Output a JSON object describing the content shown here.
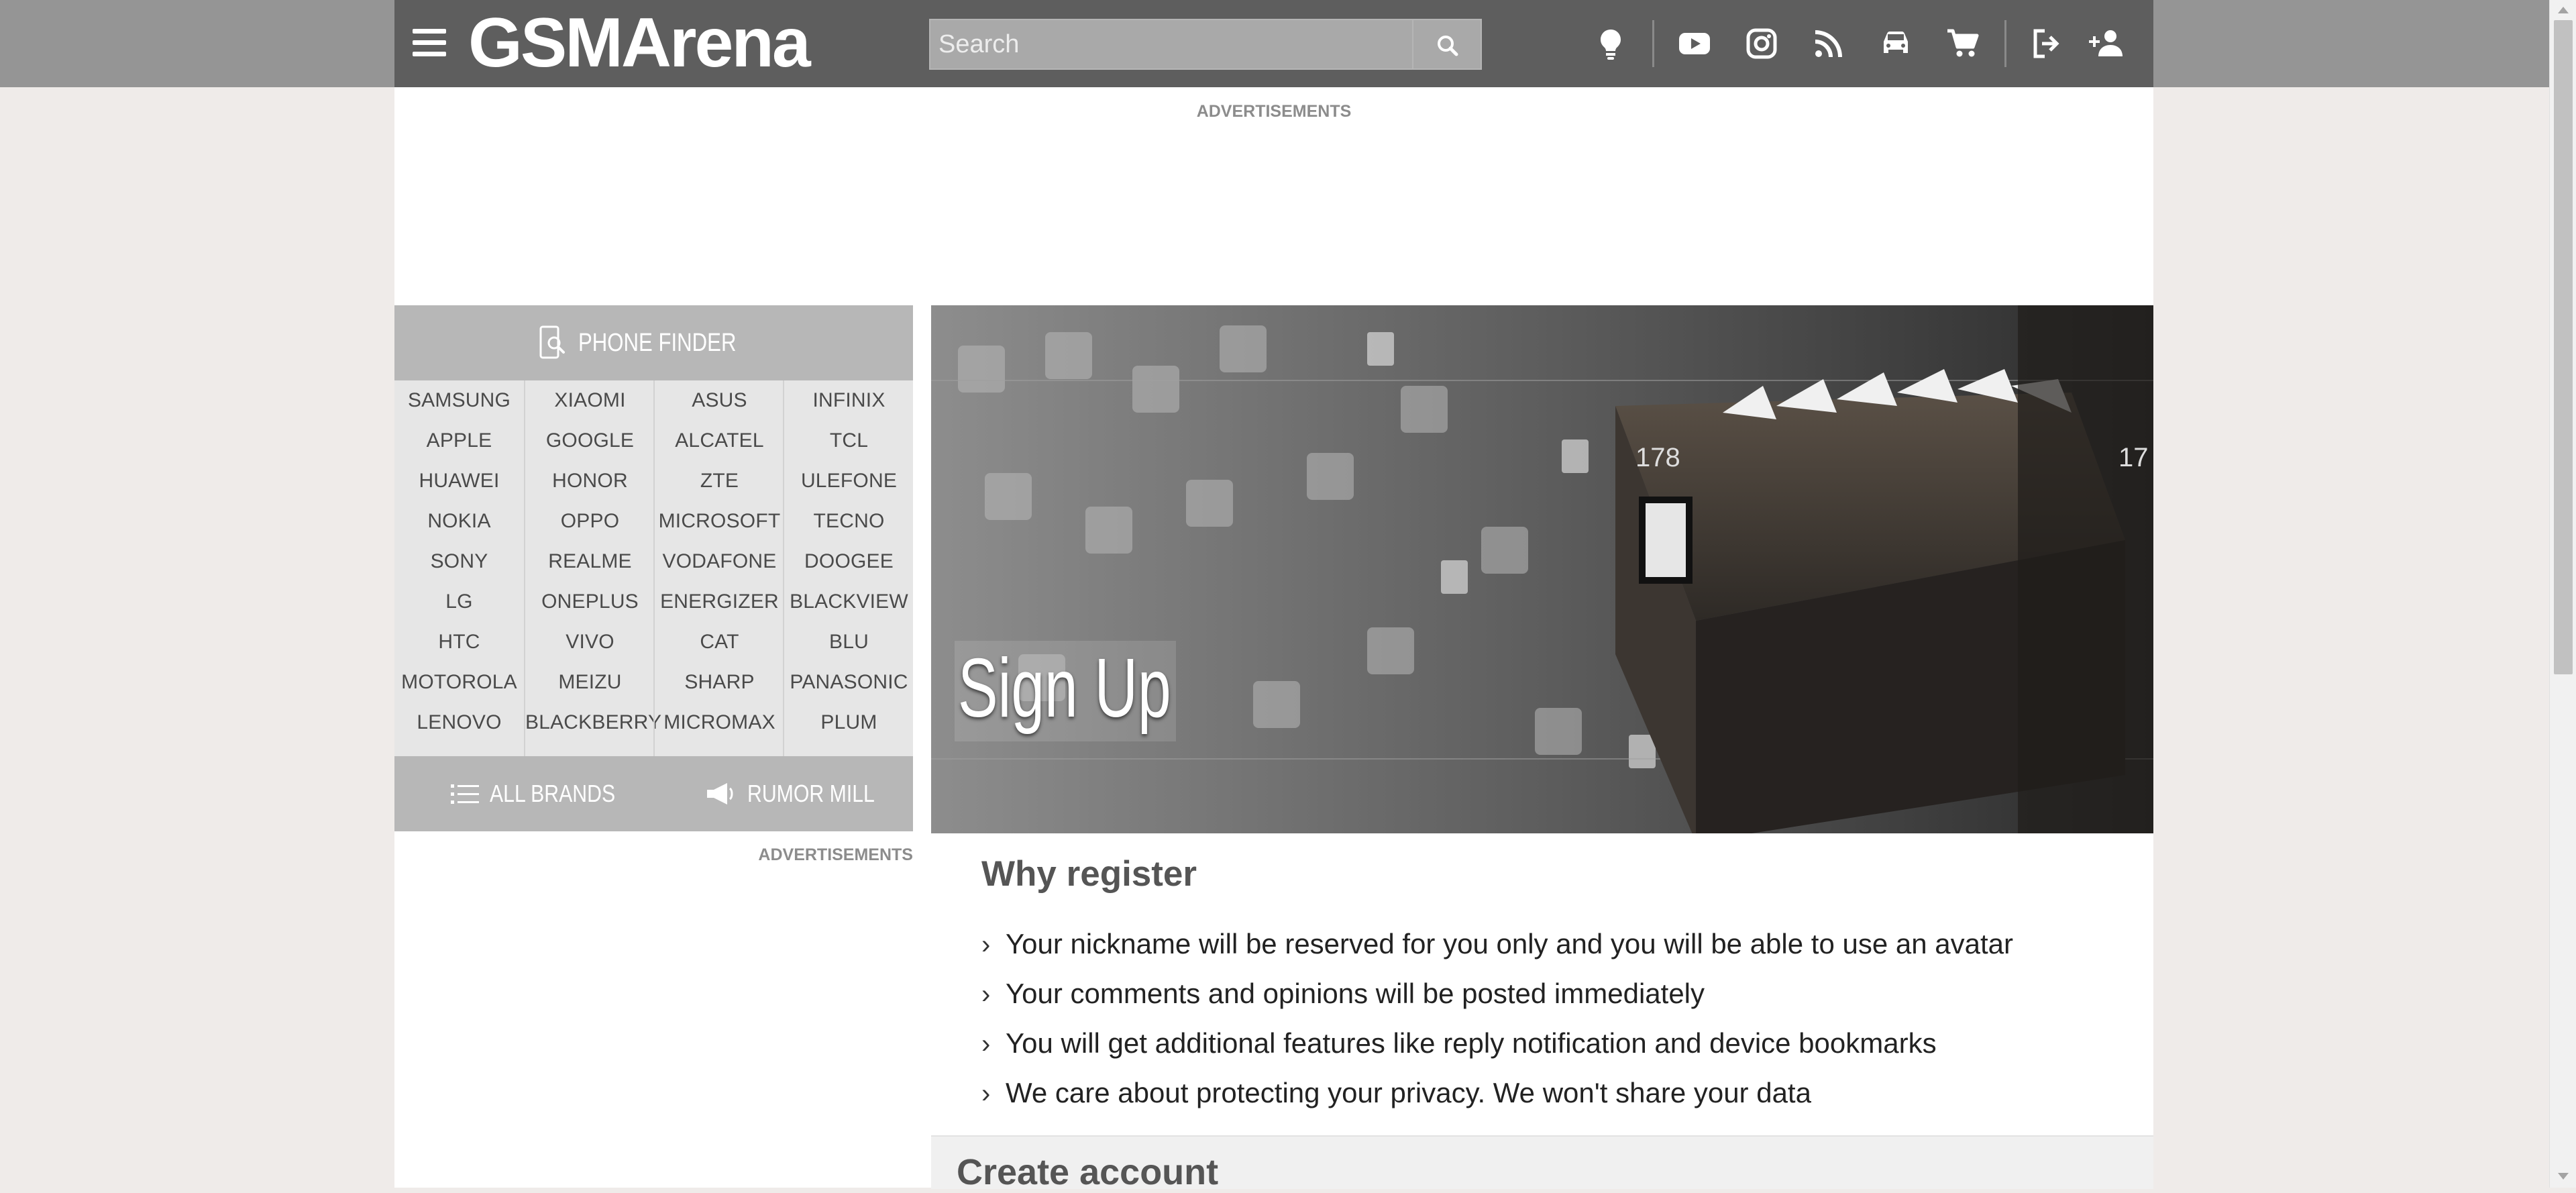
{
  "header": {
    "logo_text": "GSMArena",
    "search": {
      "placeholder": "Search",
      "value": ""
    },
    "icons": [
      "menu-icon",
      "search-icon",
      "tip-icon",
      "youtube-icon",
      "instagram-icon",
      "rss-icon",
      "car-icon",
      "cart-icon",
      "login-icon",
      "signup-icon"
    ]
  },
  "ads": {
    "top_label": "ADVERTISEMENTS",
    "side_label": "ADVERTISEMENTS"
  },
  "sidebar": {
    "phone_finder_label": "PHONE FINDER",
    "brands": [
      [
        "SAMSUNG",
        "APPLE",
        "HUAWEI",
        "NOKIA",
        "SONY",
        "LG",
        "HTC",
        "MOTOROLA",
        "LENOVO"
      ],
      [
        "XIAOMI",
        "GOOGLE",
        "HONOR",
        "OPPO",
        "REALME",
        "ONEPLUS",
        "VIVO",
        "MEIZU",
        "BLACKBERRY"
      ],
      [
        "ASUS",
        "ALCATEL",
        "ZTE",
        "MICROSOFT",
        "VODAFONE",
        "ENERGIZER",
        "CAT",
        "SHARP",
        "MICROMAX"
      ],
      [
        "INFINIX",
        "TCL",
        "ULEFONE",
        "TECNO",
        "DOOGEE",
        "BLACKVIEW",
        "BLU",
        "PANASONIC",
        "PLUM"
      ]
    ],
    "all_brands_label": "ALL BRANDS",
    "rumor_mill_label": "RUMOR MILL"
  },
  "hero": {
    "title": "Sign Up",
    "drawer_labels": [
      "178",
      "17"
    ]
  },
  "why_register": {
    "title": "Why register",
    "items": [
      "Your nickname will be reserved for you only and you will be able to use an avatar",
      "Your comments and opinions will be posted immediately",
      "You will get additional features like reply notification and device bookmarks",
      "We care about protecting your privacy. We won't share your data"
    ]
  },
  "create_account": {
    "title": "Create account"
  },
  "colors": {
    "topbar": "#5e5e5e",
    "topband": "#959595",
    "page_bg": "#efebe9",
    "sidebar_bar": "#b7b7b7",
    "brand_grid": "#e6e6e6"
  }
}
